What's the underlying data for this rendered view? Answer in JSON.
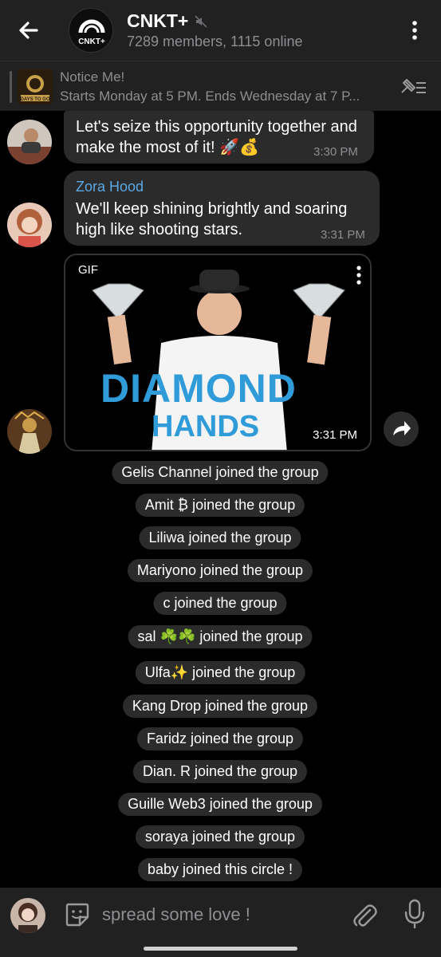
{
  "header": {
    "title": "CNKT+",
    "subtitle": "7289 members, 1115 online",
    "avatar_text": "CNKT+"
  },
  "pinned": {
    "title": "Notice Me!",
    "text": "Starts Monday at 5 PM. Ends Wednesday at 7 P...",
    "thumb_text": "DAYS TO GO"
  },
  "messages": [
    {
      "text": "Let's seize this opportunity together and make the most of it! 🚀💰",
      "time": "3:30 PM"
    },
    {
      "sender": "Zora Hood",
      "text": "We'll keep shining brightly and soaring high like shooting stars.",
      "time": "3:31 PM"
    },
    {
      "gif_label": "GIF",
      "gif_line1": "DIAMOND",
      "gif_line2": "HANDS",
      "time": "3:31 PM"
    }
  ],
  "system_messages": [
    "Gelis Channel joined the group",
    "Amit ₿ joined the group",
    "Liliwa joined the group",
    "Mariyono joined the group",
    "c joined the group",
    "sal ☘️☘️ joined the group",
    "Ulfa✨ joined the group",
    "Kang Drop joined the group",
    "Faridz joined the group",
    "Dian. R joined the group",
    "Guille Web3 joined the group",
    "soraya joined the group",
    "baby joined this circle !"
  ],
  "input": {
    "placeholder": "spread some love !"
  },
  "colors": {
    "header_bg": "#212121",
    "bubble_bg": "#2b2b2b",
    "sender_name": "#5aa9e6",
    "muted_text": "#8e8e93",
    "gif_text": "#2f9bd9"
  }
}
